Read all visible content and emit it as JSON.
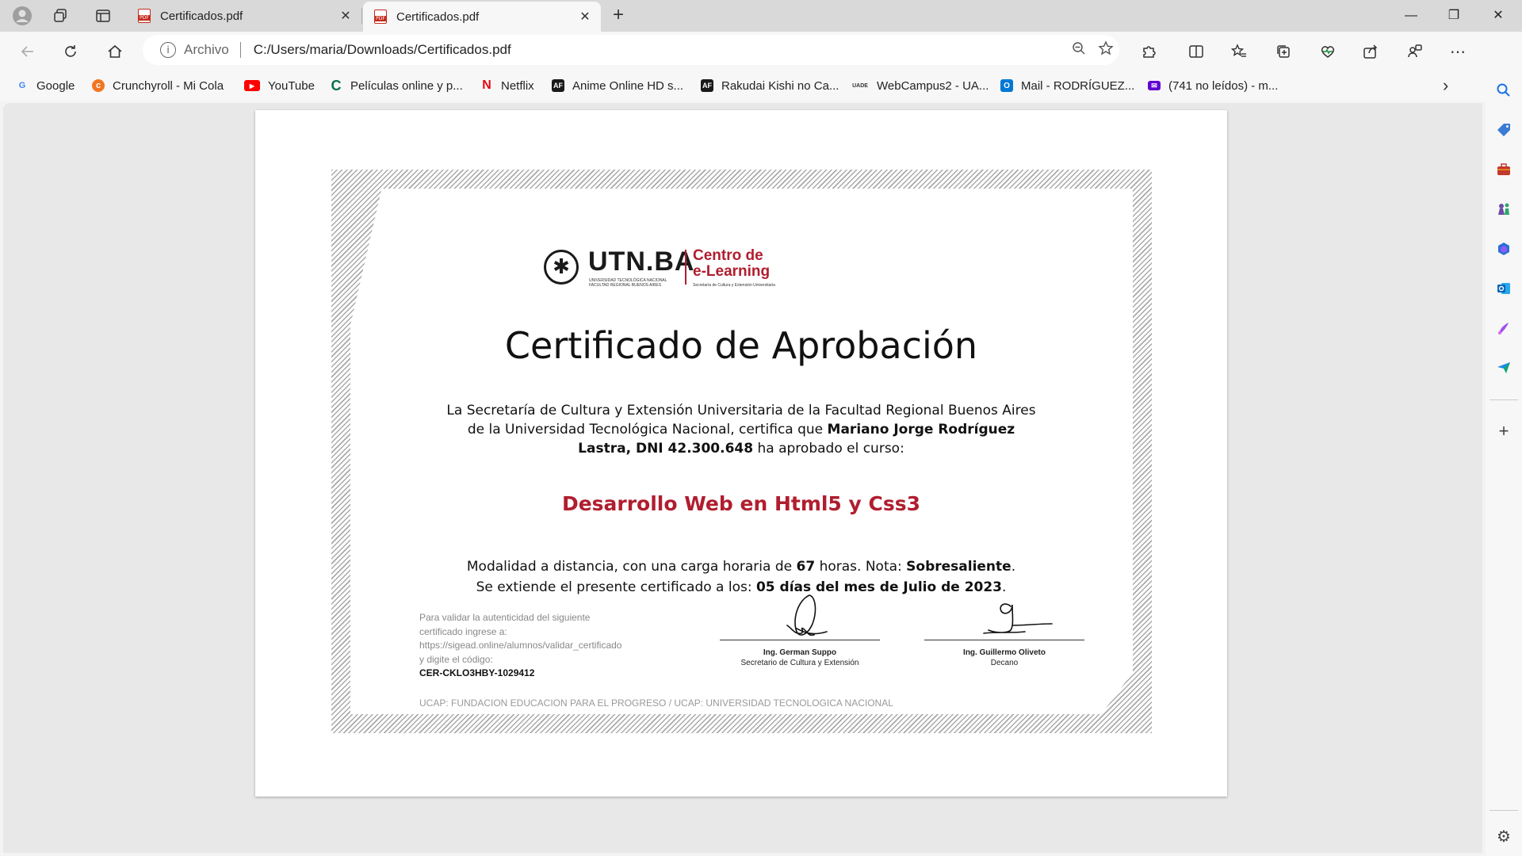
{
  "tabs": [
    {
      "title": "Certificados.pdf",
      "active": false
    },
    {
      "title": "Certificados.pdf",
      "active": true
    }
  ],
  "address": {
    "scheme_label": "Archivo",
    "url": "C:/Users/maria/Downloads/Certificados.pdf"
  },
  "favorites": [
    {
      "label": "Google",
      "icon": "google-icon",
      "color": "#4285f4"
    },
    {
      "label": "Crunchyroll - Mi Cola",
      "icon": "crunchyroll-icon",
      "color": "#f47521"
    },
    {
      "label": "YouTube",
      "icon": "youtube-icon",
      "color": "#ff0000"
    },
    {
      "label": "Películas online y p...",
      "icon": "cuevana-icon",
      "color": "#0a6e4d"
    },
    {
      "label": "Netflix",
      "icon": "netflix-icon",
      "color": "#e50914"
    },
    {
      "label": "Anime Online HD s...",
      "icon": "animeflv-icon",
      "color": "#1a1a1a"
    },
    {
      "label": "Rakudai Kishi no Ca...",
      "icon": "animeflv-icon",
      "color": "#1a1a1a"
    },
    {
      "label": "WebCampus2 - UA...",
      "icon": "uade-icon",
      "color": "#333333"
    },
    {
      "label": "Mail - RODRÍGUEZ...",
      "icon": "outlook-icon",
      "color": "#0078d4"
    },
    {
      "label": "(741 no leídos) - m...",
      "icon": "yahoo-mail-icon",
      "color": "#6001d2"
    }
  ],
  "certificate": {
    "logo": {
      "utn": "UTN.BA",
      "utn_sub": "UNIVERSIDAD TECNOLÓGICA NACIONAL FACULTAD REGIONAL BUENOS AIRES",
      "cel_line1": "Centro de",
      "cel_line2": "e-Learning",
      "cel_sub": "Secretaría de Cultura y Extensión Universitaria"
    },
    "title": "Certificado de Aprobación",
    "para_pre": "La Secretaría de Cultura y Extensión Universitaria de la Facultad Regional Buenos Aires de la Universidad Tecnológica Nacional, certifica que ",
    "para_name": "Mariano Jorge Rodríguez Lastra, DNI 42.300.648",
    "para_post": " ha aprobado el curso:",
    "course": "Desarrollo Web en Html5 y Css3",
    "details_1_pre": "Modalidad a distancia, con una carga horaria de ",
    "hours": "67",
    "details_1_mid": " horas. Nota: ",
    "grade": "Sobresaliente",
    "details_1_end": ".",
    "details_2_pre": "Se extiende el presente certificado a los: ",
    "date": "05 días del mes de Julio de 2023",
    "details_2_end": ".",
    "validate_lines": [
      "Para validar la autenticidad del siguiente",
      "certificado ingrese a:",
      "https://sigead.online/alumnos/validar_certificado",
      "y digite el código:"
    ],
    "code": "CER-CKLO3HBY-1029412",
    "signatures": [
      {
        "name": "Ing. German Suppo",
        "role": "Secretario de Cultura y Extensión"
      },
      {
        "name": "Ing. Guillermo Oliveto",
        "role": "Decano"
      }
    ],
    "footer": "UCAP: FUNDACION EDUCACION PARA EL PROGRESO / UCAP: UNIVERSIDAD TECNOLOGICA NACIONAL"
  }
}
